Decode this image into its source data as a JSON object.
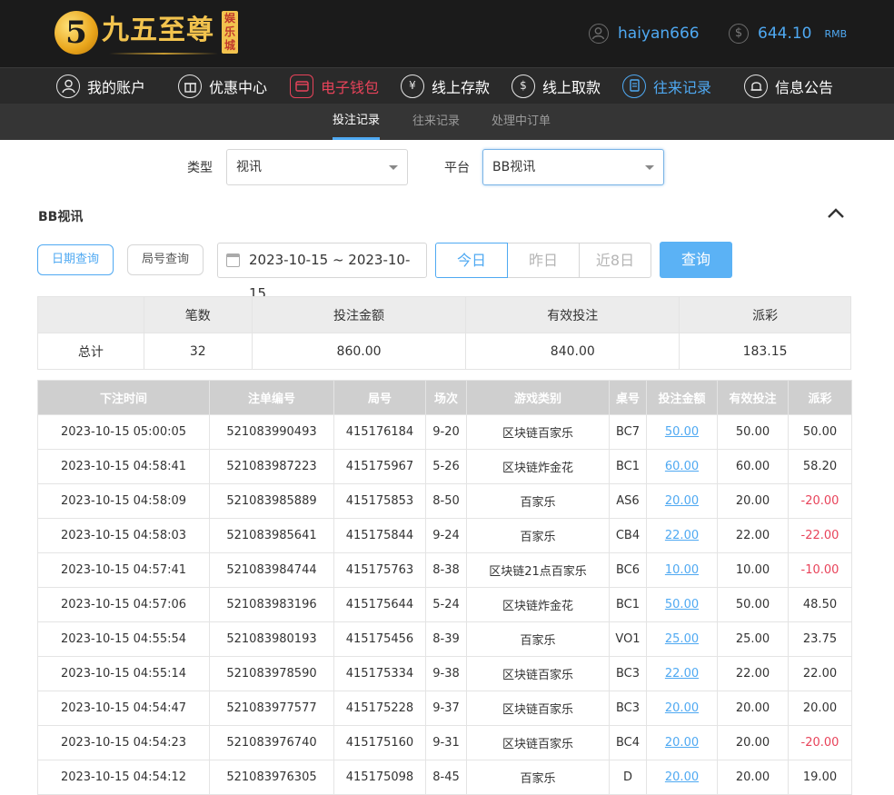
{
  "brand": {
    "mark": "5",
    "name": "九五至尊",
    "sub": "娱乐城",
    "gold": "#f2c34e"
  },
  "header": {
    "username": "haiyan666",
    "balance": "644.10",
    "currency": "RMB",
    "user_icon": "user-icon",
    "balance_icon": "dollar-icon"
  },
  "nav": [
    {
      "label": "我的账户",
      "icon": "person-icon"
    },
    {
      "label": "优惠中心",
      "icon": "gift-icon"
    },
    {
      "label": "电子钱包",
      "icon": "wallet-icon"
    },
    {
      "label": "线上存款",
      "icon": "deposit-icon"
    },
    {
      "label": "线上取款",
      "icon": "withdraw-icon"
    },
    {
      "label": "往来记录",
      "icon": "records-icon"
    },
    {
      "label": "信息公告",
      "icon": "bell-icon"
    }
  ],
  "subnav": [
    "投注记录",
    "往来记录",
    "处理中订单"
  ],
  "filters": {
    "type_label": "类型",
    "type_value": "视讯",
    "platform_label": "平台",
    "platform_value": "BB视讯"
  },
  "section_title": "BB视讯",
  "query": {
    "date_query": "日期查询",
    "round_query": "局号查询",
    "date_range": "2023-10-15 ~ 2023-10-15",
    "today": "今日",
    "yesterday": "昨日",
    "last8": "近8日",
    "search": "查询"
  },
  "summary": {
    "headers": [
      "",
      "笔数",
      "投注金额",
      "有效投注",
      "派彩"
    ],
    "row": [
      "总计",
      "32",
      "860.00",
      "840.00",
      "183.15"
    ]
  },
  "table": {
    "headers": [
      "下注时间",
      "注单编号",
      "局号",
      "场次",
      "游戏类别",
      "桌号",
      "投注金额",
      "有效投注",
      "派彩"
    ],
    "rows": [
      [
        "2023-10-15 05:00:05",
        "521083990493",
        "415176184",
        "9-20",
        "区块链百家乐",
        "BC7",
        "50.00",
        "50.00",
        "50.00"
      ],
      [
        "2023-10-15 04:58:41",
        "521083987223",
        "415175967",
        "5-26",
        "区块链炸金花",
        "BC1",
        "60.00",
        "60.00",
        "58.20"
      ],
      [
        "2023-10-15 04:58:09",
        "521083985889",
        "415175853",
        "8-50",
        "百家乐",
        "AS6",
        "20.00",
        "20.00",
        "-20.00"
      ],
      [
        "2023-10-15 04:58:03",
        "521083985641",
        "415175844",
        "9-24",
        "百家乐",
        "CB4",
        "22.00",
        "22.00",
        "-22.00"
      ],
      [
        "2023-10-15 04:57:41",
        "521083984744",
        "415175763",
        "8-38",
        "区块链21点百家乐",
        "BC6",
        "10.00",
        "10.00",
        "-10.00"
      ],
      [
        "2023-10-15 04:57:06",
        "521083983196",
        "415175644",
        "5-24",
        "区块链炸金花",
        "BC1",
        "50.00",
        "50.00",
        "48.50"
      ],
      [
        "2023-10-15 04:55:54",
        "521083980193",
        "415175456",
        "8-39",
        "百家乐",
        "VO1",
        "25.00",
        "25.00",
        "23.75"
      ],
      [
        "2023-10-15 04:55:14",
        "521083978590",
        "415175334",
        "9-38",
        "区块链百家乐",
        "BC3",
        "22.00",
        "22.00",
        "22.00"
      ],
      [
        "2023-10-15 04:54:47",
        "521083977577",
        "415175228",
        "9-37",
        "区块链百家乐",
        "BC3",
        "20.00",
        "20.00",
        "20.00"
      ],
      [
        "2023-10-15 04:54:23",
        "521083976740",
        "415175160",
        "9-31",
        "区块链百家乐",
        "BC4",
        "20.00",
        "20.00",
        "-20.00"
      ],
      [
        "2023-10-15 04:54:12",
        "521083976305",
        "415175098",
        "8-45",
        "百家乐",
        "D",
        "20.00",
        "20.00",
        "19.00"
      ]
    ]
  },
  "colors": {
    "accent": "#4fa9f2",
    "negative": "#e8435a",
    "header_bg": "#1b1b1b"
  }
}
